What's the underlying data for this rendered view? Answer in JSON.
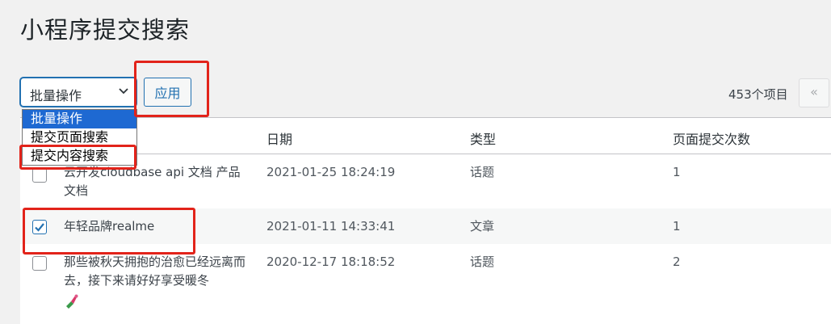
{
  "page": {
    "title": "小程序提交搜索"
  },
  "toolbar": {
    "bulk_select_value": "批量操作",
    "apply_label": "应用",
    "items_count": "453个项目",
    "first_page": "«"
  },
  "dropdown": {
    "options": [
      "批量操作",
      "提交页面搜索",
      "提交内容搜索"
    ]
  },
  "table": {
    "columns": [
      "日期",
      "类型",
      "页面提交次数"
    ],
    "rows": [
      {
        "title": "云开发cloudbase api 文档 产品文档",
        "date": "2021-01-25 18:24:19",
        "type": "话题",
        "count": "1",
        "checked": false
      },
      {
        "title": "年轻品牌realme",
        "date": "2021-01-11 14:33:41",
        "type": "文章",
        "count": "1",
        "checked": true
      },
      {
        "title": "那些被秋天拥抱的治愈已经远离而去，接下来请好好享受暖冬",
        "date": "2020-12-17 18:18:52",
        "type": "话题",
        "count": "2",
        "checked": false
      }
    ]
  },
  "colors": {
    "accent": "#2271b1",
    "highlight": "#e2231a",
    "selected_option": "#1e69d2"
  }
}
